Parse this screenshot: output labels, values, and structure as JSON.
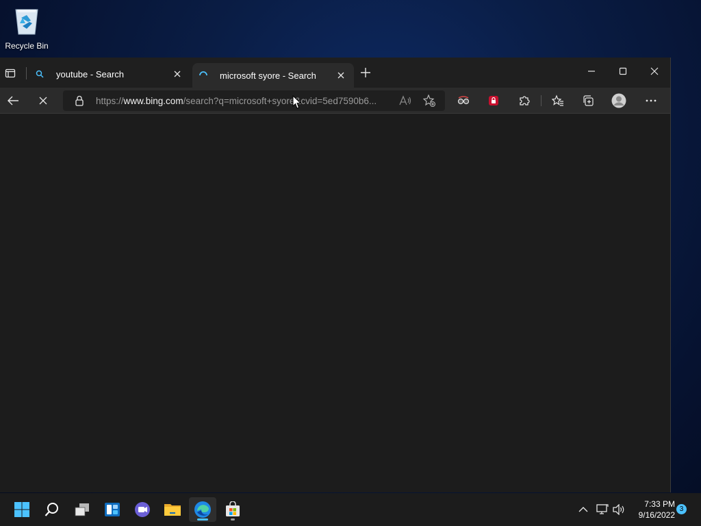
{
  "desktop": {
    "icons": [
      {
        "label": "Recycle Bin",
        "icon": "recycle-bin-icon"
      }
    ]
  },
  "browser": {
    "tabs": [
      {
        "label": "youtube - Search",
        "icon": "search-icon",
        "active": false
      },
      {
        "label": "microsoft syore - Search",
        "icon": "loading-spinner-icon",
        "active": true
      }
    ],
    "address": {
      "scheme": "https://",
      "host": "www.bing.com",
      "path": "/search?q=microsoft+syore&cvid=5ed7590b6..."
    },
    "status": "loading"
  },
  "taskbar": {
    "apps": [
      "start-icon",
      "search-icon",
      "task-view-icon",
      "widgets-icon",
      "chat-icon",
      "file-explorer-icon",
      "edge-icon",
      "store-icon"
    ],
    "active_app": "edge-icon",
    "clock": {
      "time": "7:33 PM",
      "date": "9/16/2022"
    },
    "notification_count": "3"
  },
  "colors": {
    "accent": "#4cc2ff",
    "window_bg": "#1c1c1c",
    "toolbar_bg": "#2b2b2b"
  }
}
